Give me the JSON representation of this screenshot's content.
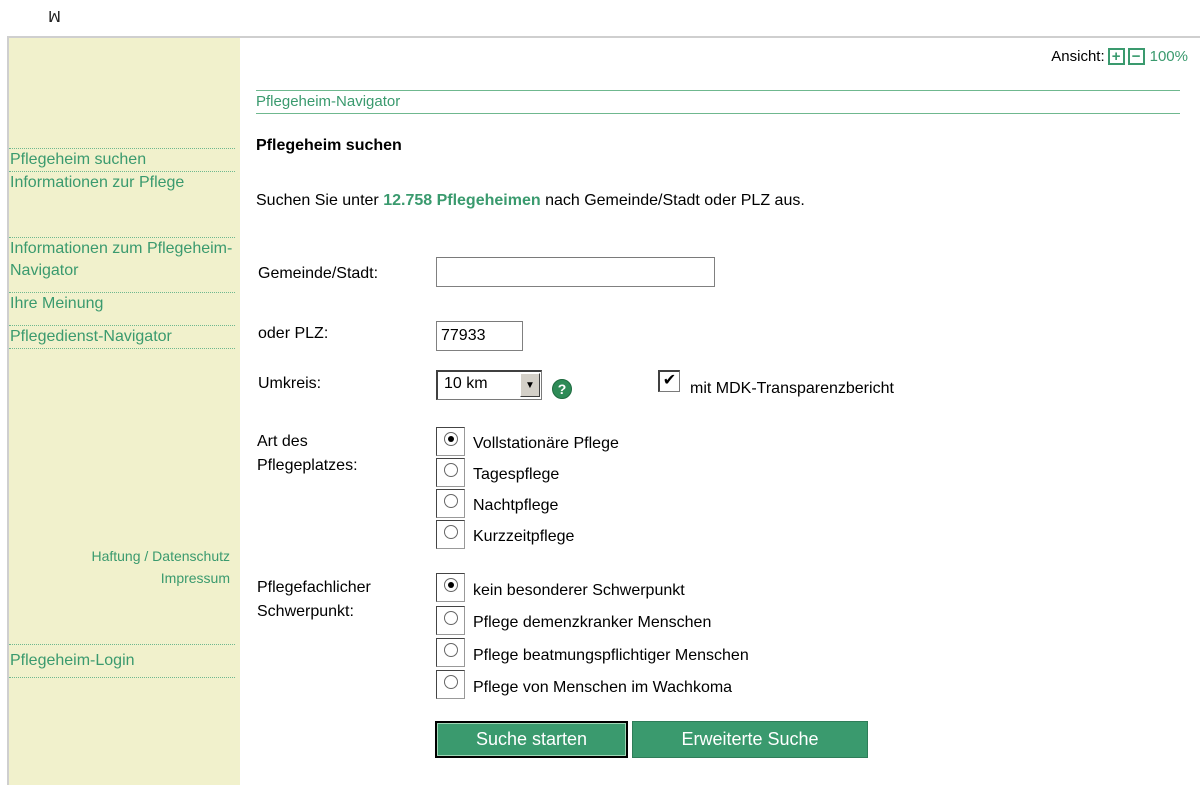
{
  "logo": {
    "text": "ꟽ"
  },
  "sidebar": {
    "items": [
      {
        "label": "Pflegeheim suchen"
      },
      {
        "label": "Informationen zur Pflege"
      },
      {
        "label": "Informationen zum Pflegeheim-Navigator"
      },
      {
        "label": "Ihre Meinung"
      },
      {
        "label": "Pflegedienst-Navigator"
      }
    ],
    "footer_links": [
      {
        "label": "Haftung / Datenschutz"
      },
      {
        "label": "Impressum"
      }
    ],
    "login": {
      "label": "Pflegeheim-Login"
    }
  },
  "view": {
    "label": "Ansicht:",
    "zoom_in": "+",
    "zoom_out": "−",
    "zoom_level": "100%"
  },
  "breadcrumb": "Pflegeheim-Navigator",
  "page_title": "Pflegeheim suchen",
  "intro": {
    "before": "Suchen Sie unter ",
    "highlight": "12.758 Pflegeheimen",
    "after": " nach Gemeinde/Stadt oder PLZ aus."
  },
  "form": {
    "city": {
      "label": "Gemeinde/Stadt:",
      "value": ""
    },
    "plz": {
      "label": "oder PLZ:",
      "value": "77933"
    },
    "radius": {
      "label": "Umkreis:",
      "selected": "10 km"
    },
    "mdk": {
      "label": "mit MDK-Transparenzbericht",
      "checked": "✔"
    },
    "care_type": {
      "label_line1": "Art des",
      "label_line2": "Pflegeplatzes:",
      "options": [
        {
          "label": "Vollstationäre Pflege"
        },
        {
          "label": "Tagespflege"
        },
        {
          "label": "Nachtpflege"
        },
        {
          "label": "Kurzzeitpflege"
        }
      ]
    },
    "focus": {
      "label_line1": "Pflegefachlicher",
      "label_line2": "Schwerpunkt:",
      "options": [
        {
          "label": "kein besonderer Schwerpunkt"
        },
        {
          "label": "Pflege demenzkranker Menschen"
        },
        {
          "label": "Pflege beatmungspflichtiger Menschen"
        },
        {
          "label": "Pflege von Menschen im Wachkoma"
        }
      ]
    }
  },
  "buttons": {
    "search": "Suche starten",
    "advanced": "Erweiterte Suche"
  },
  "colors": {
    "accent": "#3a9a6e",
    "sidebar_bg": "#f1f1cc"
  }
}
